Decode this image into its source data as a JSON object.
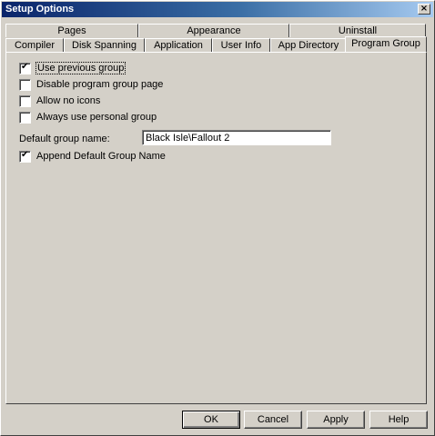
{
  "window": {
    "title": "Setup Options",
    "close_glyph": "×"
  },
  "tabs_back": [
    {
      "label": "Pages"
    },
    {
      "label": "Appearance"
    },
    {
      "label": "Uninstall"
    }
  ],
  "tabs_front": [
    {
      "label": "Compiler"
    },
    {
      "label": "Disk Spanning"
    },
    {
      "label": "Application"
    },
    {
      "label": "User Info"
    },
    {
      "label": "App Directory"
    },
    {
      "label": "Program Group",
      "active": true
    }
  ],
  "options": [
    {
      "label": "Use previous group",
      "checked": true,
      "focused": true
    },
    {
      "label": "Disable program group page",
      "checked": false
    },
    {
      "label": "Allow no icons",
      "checked": false
    },
    {
      "label": "Always use personal group",
      "checked": false
    }
  ],
  "default_group": {
    "label": "Default group name:",
    "value": "Black Isle\\Fallout 2"
  },
  "append_option": {
    "label": "Append Default Group Name",
    "checked": true
  },
  "buttons": {
    "ok": "OK",
    "cancel": "Cancel",
    "apply": "Apply",
    "help": "Help"
  }
}
